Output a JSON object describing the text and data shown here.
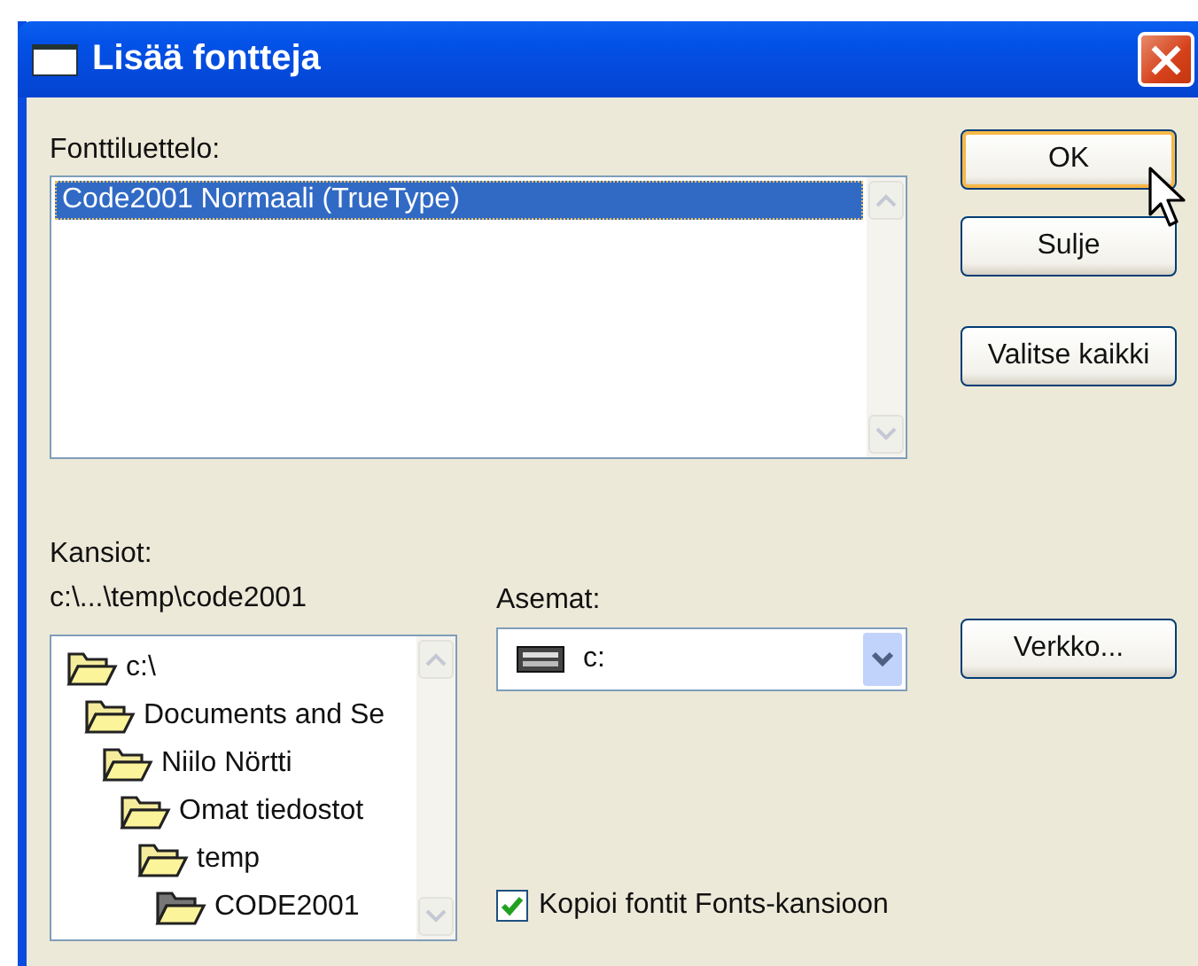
{
  "window": {
    "title": "Lisää fontteja"
  },
  "font_list": {
    "label": "Fonttiluettelo:",
    "items": [
      {
        "name": "Code2001 Normaali (TrueType)",
        "selected": true
      }
    ]
  },
  "buttons": [
    {
      "label": "OK",
      "focused": true
    },
    {
      "label": "Sulje",
      "focused": false
    },
    {
      "label": "Valitse kaikki",
      "focused": false
    }
  ],
  "folders": {
    "label": "Kansiot:",
    "path": "c:\\...\\temp\\code2001",
    "tree": [
      {
        "name": "c:\\",
        "current": false,
        "children": [
          {
            "name": "Documents and Se",
            "current": false,
            "children": [
              {
                "name": "Niilo Nörtti",
                "current": false,
                "children": [
                  {
                    "name": "Omat tiedostot",
                    "current": false,
                    "children": [
                      {
                        "name": "temp",
                        "current": false,
                        "children": [
                          {
                            "name": "CODE2001",
                            "current": true
                          }
                        ]
                      }
                    ]
                  }
                ]
              }
            ]
          }
        ]
      }
    ]
  },
  "drives": {
    "label": "Asemat:",
    "value": "c:"
  },
  "network_button": {
    "label": "Verkko..."
  },
  "copy_checkbox": {
    "label": "Kopioi fontit Fonts-kansioon",
    "checked": true
  }
}
